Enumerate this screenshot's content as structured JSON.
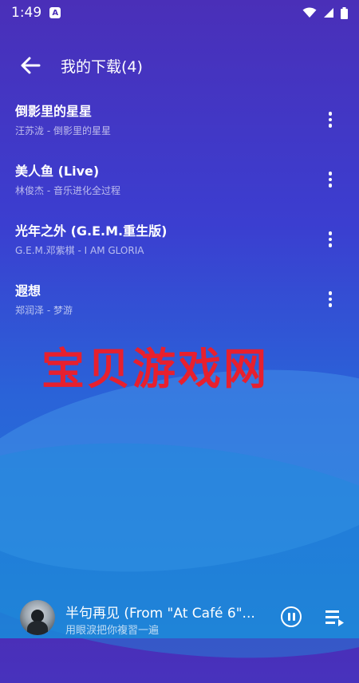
{
  "status_bar": {
    "time": "1:49",
    "badge_letter": "A"
  },
  "header": {
    "title": "我的下载(4)"
  },
  "songs": [
    {
      "title": "倒影里的星星",
      "subtitle": "汪苏泷 - 倒影里的星星"
    },
    {
      "title": "美人鱼 (Live)",
      "subtitle": "林俊杰 - 音乐进化全过程"
    },
    {
      "title": "光年之外 (G.E.M.重生版)",
      "subtitle": "G.E.M.邓紫棋 - I AM GLORIA"
    },
    {
      "title": "遐想",
      "subtitle": "郑润泽 - 梦游"
    }
  ],
  "watermark": "宝贝游戏网",
  "now_playing": {
    "title": "半句再见 (From \"At Café 6\"...",
    "subtitle": "用眼淚把你複習一遍"
  },
  "colors": {
    "background_top": "#4a2fb8",
    "background_bottom": "#1f7fd6",
    "watermark": "#e7202e"
  },
  "icons": [
    "arrow-back-icon",
    "more-vert-icon",
    "pause-icon",
    "queue-icon",
    "wifi-icon",
    "signal-icon",
    "battery-icon"
  ]
}
